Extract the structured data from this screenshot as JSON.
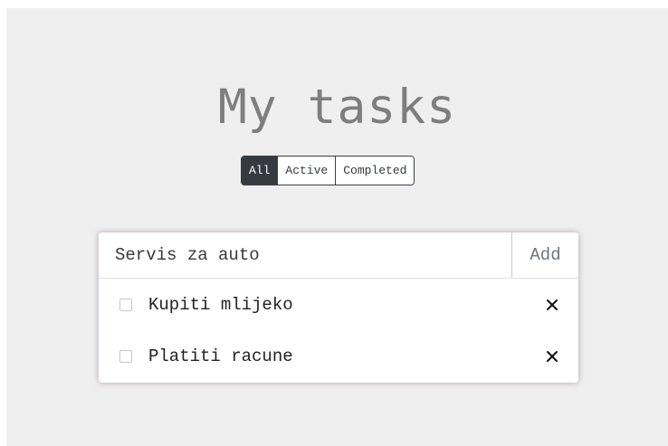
{
  "header": {
    "title": "My tasks"
  },
  "filters": {
    "items": [
      {
        "label": "All",
        "active": true
      },
      {
        "label": "Active",
        "active": false
      },
      {
        "label": "Completed",
        "active": false
      }
    ]
  },
  "new_task": {
    "value": "Servis za auto",
    "add_label": "Add"
  },
  "tasks": [
    {
      "label": "Kupiti mlijeko",
      "checked": false,
      "delete_icon": "close-icon"
    },
    {
      "label": "Platiti racune",
      "checked": false,
      "delete_icon": "close-icon"
    }
  ],
  "colors": {
    "background": "#efefef",
    "active_filter": "#343a40",
    "title": "#7e7e7e"
  }
}
